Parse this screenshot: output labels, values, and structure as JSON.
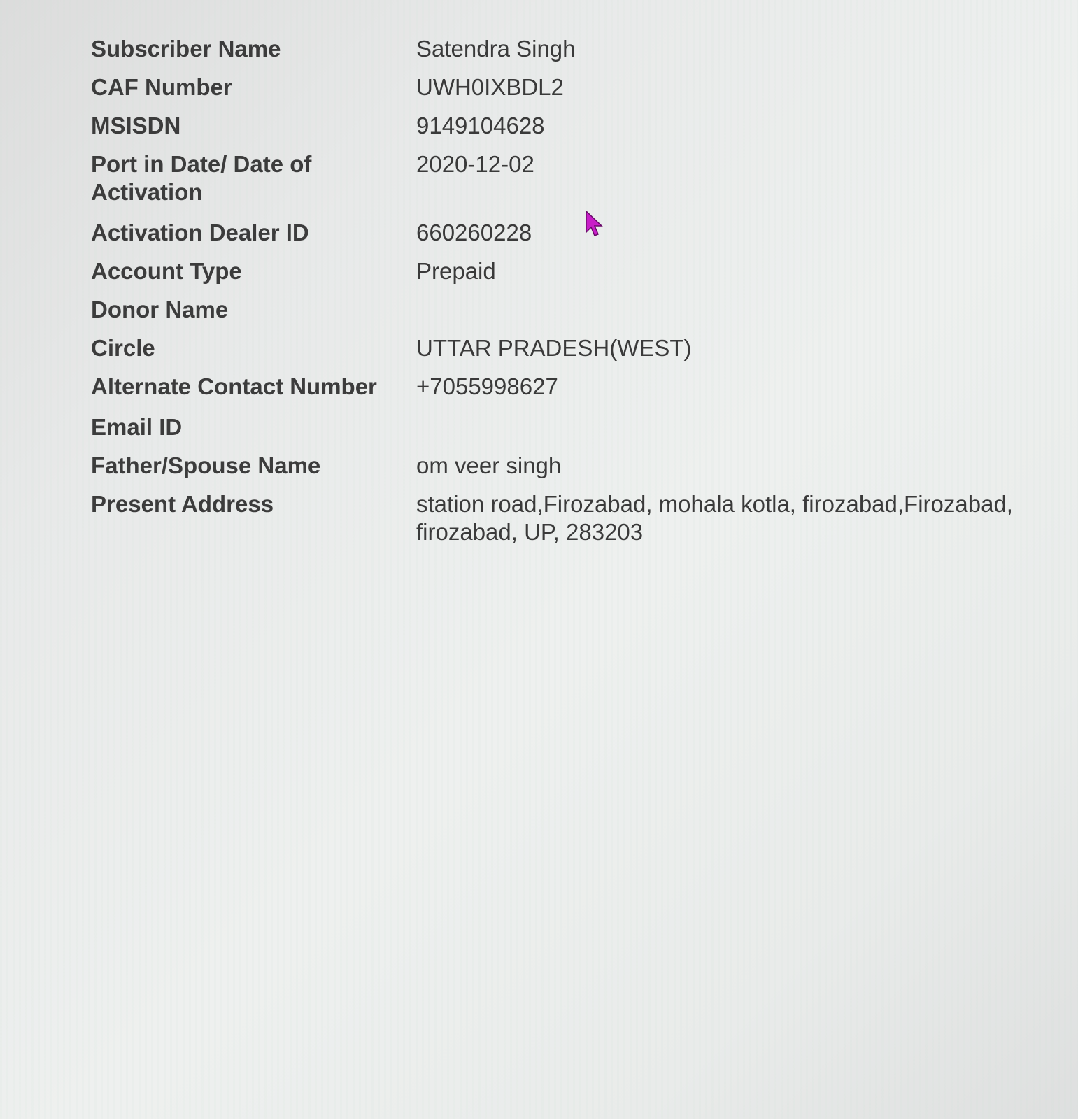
{
  "subscriber_details": {
    "rows": [
      {
        "label": "Subscriber Name",
        "value": "Satendra Singh"
      },
      {
        "label": "CAF Number",
        "value": "UWH0IXBDL2"
      },
      {
        "label": "MSISDN",
        "value": "9149104628"
      },
      {
        "label": "Port in Date/ Date of Activation",
        "value": "2020-12-02"
      },
      {
        "label": "Activation Dealer ID",
        "value": "660260228"
      },
      {
        "label": "Account Type",
        "value": "Prepaid"
      },
      {
        "label": "Donor Name",
        "value": ""
      },
      {
        "label": "Circle",
        "value": "UTTAR PRADESH(WEST)"
      },
      {
        "label": "Alternate Contact Number",
        "value": "+7055998627"
      },
      {
        "label": "Email ID",
        "value": ""
      },
      {
        "label": "Father/Spouse Name",
        "value": "om veer singh"
      },
      {
        "label": "Present Address",
        "value": "station road,Firozabad, mohala kotla, firozabad,Firozabad, firozabad, UP, 283203"
      }
    ]
  },
  "cursor": {
    "icon": "mouse-pointer-icon",
    "color": "#c81ec8"
  }
}
